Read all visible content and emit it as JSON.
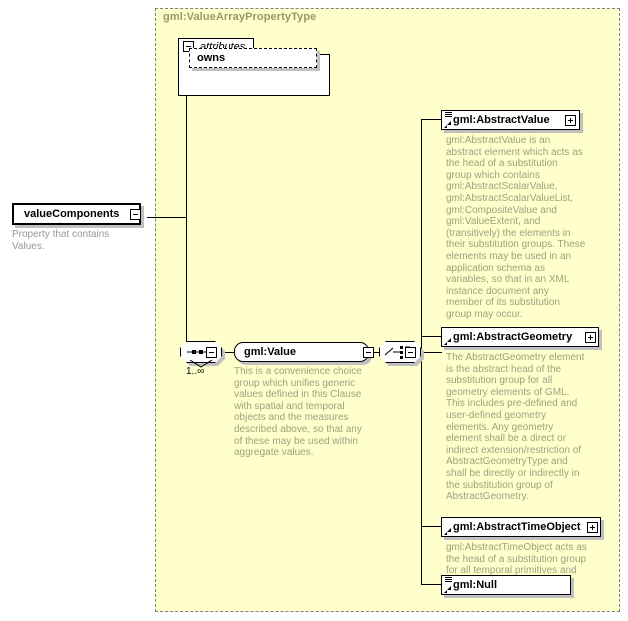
{
  "diagram": {
    "kind": "xml-schema-element-diagram",
    "background_color": "#ffffff",
    "type_region_color": "#ffffcc",
    "type_region_border_color": "#808080",
    "title": "gml:ValueArrayPropertyType",
    "title_color": "#999966"
  },
  "root_element": {
    "name": "valueComponents",
    "expander": "minus",
    "documentation": "Property that contains Values."
  },
  "attributes_group": {
    "label": "attributes",
    "expander": "minus",
    "items": [
      {
        "name": "owns"
      }
    ]
  },
  "compositors": {
    "sequence": {
      "icon": "sequence-icon",
      "expander": "minus",
      "occurrence": "1..∞"
    },
    "choice": {
      "icon": "choice-icon",
      "expander": "minus"
    }
  },
  "group_element": {
    "name": "gml:Value",
    "expander": "minus",
    "documentation": "This is a convenience choice group which unifies generic values defined in this Clause with spatial and temporal objects and the measures described above, so that any of these may be used within aggregate values."
  },
  "choice_members": [
    {
      "name": "gml:AbstractValue",
      "has_type_icon": true,
      "has_ref_icon": true,
      "expander": "plus",
      "documentation": "gml:AbstractValue is an abstract element which acts as the head of a substitution group which contains gml:AbstractScalarValue, gml:AbstractScalarValueList, gml:CompositeValue and gml:ValueExtent, and (transitively) the elements in their substitution groups. These elements may be used in an application schema as variables, so that in an XML instance document any member of its substitution group may occur."
    },
    {
      "name": "gml:AbstractGeometry",
      "has_type_icon": false,
      "has_ref_icon": true,
      "expander": "plus",
      "documentation": "The AbstractGeometry element is the abstract head of the substitution group for all geometry elements of GML. This includes pre-defined and user-defined geometry elements. Any geometry element shall be a direct or indirect extension/restriction of AbstractGeometryType and shall be directly or indirectly in the substitution group of AbstractGeometry."
    },
    {
      "name": "gml:AbstractTimeObject",
      "has_type_icon": false,
      "has_ref_icon": true,
      "expander": "plus",
      "documentation": "gml:AbstractTimeObject acts as the head of a substitution group for all temporal primitives and complexes."
    },
    {
      "name": "gml:Null",
      "has_type_icon": true,
      "has_ref_icon": true,
      "expander": "none",
      "documentation": ""
    }
  ]
}
